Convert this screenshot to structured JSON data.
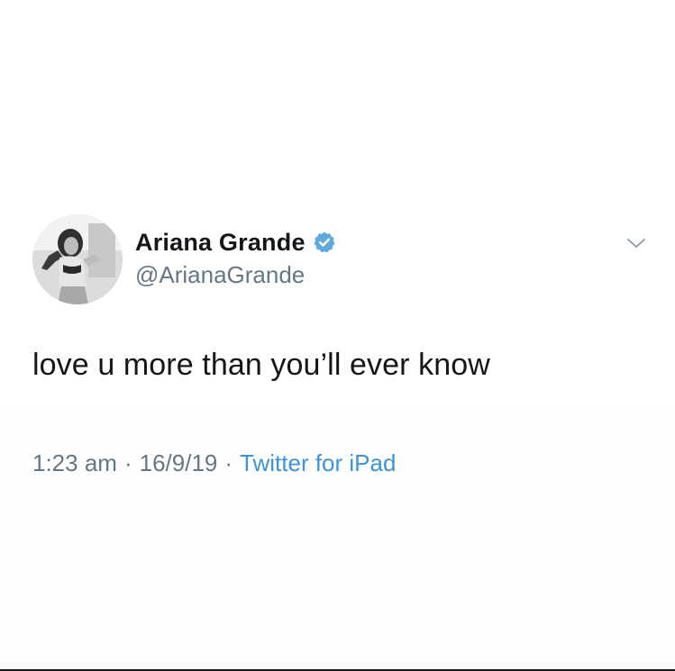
{
  "tweet": {
    "author": {
      "display_name": "Ariana Grande",
      "handle": "@ArianaGrande",
      "verified": true,
      "avatar_icon": "profile-photo"
    },
    "text": "love u more than you’ll ever know",
    "time": "1:23 am",
    "date": "16/9/19",
    "separator": "·",
    "source": "Twitter for iPad",
    "menu_icon": "chevron-down-icon"
  },
  "colors": {
    "text_primary": "#14171a",
    "text_secondary": "#657786",
    "link": "#3b94d9",
    "verified_badge": "#5ea9dd"
  }
}
